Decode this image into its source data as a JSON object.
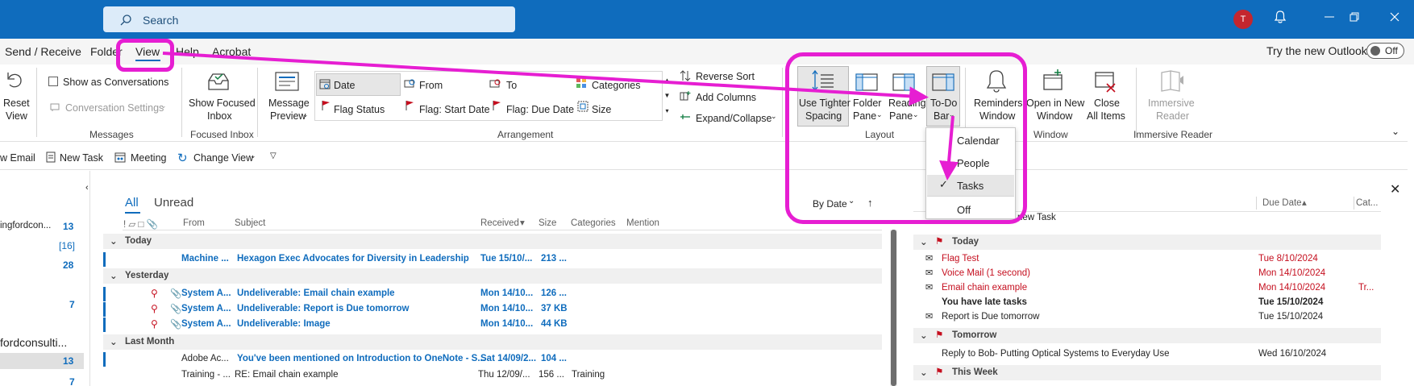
{
  "titlebar": {
    "search_placeholder": "Search",
    "avatar_initial": "T"
  },
  "menubar": {
    "items": [
      "Send / Receive",
      "Folder",
      "View",
      "Help",
      "Acrobat"
    ],
    "new_outlook_label": "Try the new Outlook",
    "toggle_label": "Off"
  },
  "ribbon": {
    "reset_view_1": "Reset",
    "reset_view_2": "View",
    "show_conversations": "Show as Conversations",
    "conversation_settings": "Conversation Settings",
    "messages_group": "Messages",
    "focused_1": "Show Focused",
    "focused_2": "Inbox",
    "focused_group": "Focused Inbox",
    "preview_1": "Message",
    "preview_2": "Preview",
    "arr_date": "Date",
    "arr_from": "From",
    "arr_to": "To",
    "arr_categories": "Categories",
    "arr_flag_status": "Flag Status",
    "arr_flag_start": "Flag: Start Date",
    "arr_flag_due": "Flag: Due Date",
    "arr_size": "Size",
    "arrangement_group": "Arrangement",
    "reverse_sort": "Reverse Sort",
    "add_columns": "Add Columns",
    "expand_collapse": "Expand/Collapse",
    "tighter_1": "Use Tighter",
    "tighter_2": "Spacing",
    "folder_pane_1": "Folder",
    "folder_pane_2": "Pane",
    "reading_pane_1": "Reading",
    "reading_pane_2": "Pane",
    "todo_1": "To-Do",
    "todo_2": "Bar",
    "layout_group": "Layout",
    "reminders_1": "Reminders",
    "reminders_2": "Window",
    "open_new_1": "Open in New",
    "open_new_2": "Window",
    "close_all_1": "Close",
    "close_all_2": "All Items",
    "window_group": "Window",
    "immersive_1": "Immersive",
    "immersive_2": "Reader",
    "immersive_group": "Immersive Reader"
  },
  "dropdown": {
    "items": [
      "Calendar",
      "People",
      "Tasks",
      "Off"
    ]
  },
  "quickbar": {
    "new_email": "w Email",
    "new_task": "New Task",
    "meeting": "Meeting",
    "change_view": "Change View"
  },
  "leftpane": {
    "account": "ingfordcon...",
    "counts": [
      "13",
      "[16]",
      "28",
      "7"
    ],
    "account2": "fordconsulti...",
    "count_bottom_1": "13",
    "count_bottom_2": "7"
  },
  "mail": {
    "tab_all": "All",
    "tab_unread": "Unread",
    "sort_label": "By Date",
    "col_from": "From",
    "col_subject": "Subject",
    "col_received": "Received",
    "col_size": "Size",
    "col_categories": "Categories",
    "col_mention": "Mention",
    "group_today": "Today",
    "group_yesterday": "Yesterday",
    "group_last_month": "Last Month",
    "rows": [
      {
        "from": "Machine ...",
        "subject": "Hexagon Exec Advocates for Diversity in Leadership",
        "received": "Tue 15/10/...",
        "size": "213 ...",
        "categories": ""
      },
      {
        "from": "System A...",
        "subject": "Undeliverable: Email chain example",
        "received": "Mon 14/10...",
        "size": "126 ...",
        "categories": ""
      },
      {
        "from": "System A...",
        "subject": "Undeliverable: Report is Due tomorrow",
        "received": "Mon 14/10...",
        "size": "37 KB",
        "categories": ""
      },
      {
        "from": "System A...",
        "subject": "Undeliverable: Image",
        "received": "Mon 14/10...",
        "size": "44 KB",
        "categories": ""
      },
      {
        "from": "Adobe Ac...",
        "subject": "You've been mentioned on Introduction to OneNote - S...",
        "received": "Sat 14/09/2...",
        "size": "104 ...",
        "categories": ""
      },
      {
        "from": "Training - ...",
        "subject": "RE: Email chain example",
        "received": "Thu 12/09/...",
        "size": "156 ...",
        "categories": "Training"
      }
    ]
  },
  "tasks": {
    "col_due": "Due Date",
    "col_cat": "Cat...",
    "new_task": "new Task",
    "group_today": "Today",
    "group_tomorrow": "Tomorrow",
    "group_week": "This Week",
    "rows": [
      {
        "subject": "Flag Test",
        "due": "Tue 8/10/2024",
        "cat": ""
      },
      {
        "subject": "Voice Mail (1 second)",
        "due": "Mon 14/10/2024",
        "cat": ""
      },
      {
        "subject": "Email chain example",
        "due": "Mon 14/10/2024",
        "cat": "Tr..."
      },
      {
        "subject": "You have late tasks",
        "due": "Tue 15/10/2024",
        "cat": ""
      },
      {
        "subject": "Report is Due tomorrow",
        "due": "Tue 15/10/2024",
        "cat": ""
      },
      {
        "subject": "Reply to Bob- Putting Optical Systems to Everyday Use",
        "due": "Wed 16/10/2024",
        "cat": ""
      }
    ]
  },
  "colors": {
    "brand": "#0f6cbd",
    "annotation": "#e61ed2",
    "overdue": "#c50f1f"
  }
}
